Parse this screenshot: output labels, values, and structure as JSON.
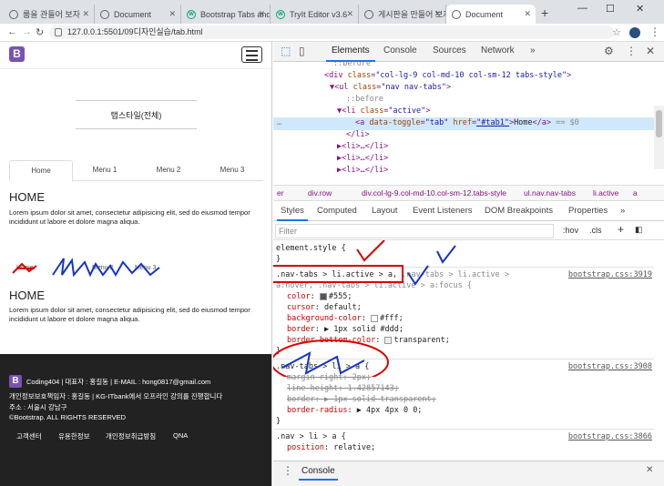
{
  "browser": {
    "tabs": [
      {
        "title": "룸을 관들어 보자",
        "icon": "globe-icon"
      },
      {
        "title": "Document",
        "icon": "globe-icon"
      },
      {
        "title": "Bootstrap Tabs and",
        "icon": "w3schools-icon"
      },
      {
        "title": "TryIt Editor v3.6",
        "icon": "w3schools-icon"
      },
      {
        "title": "게시판을 만들어 보자",
        "icon": "globe-icon"
      },
      {
        "title": "Document",
        "icon": "globe-icon",
        "active": true
      }
    ],
    "url": "127.0.0.1:5501/09디자인실습/tab.html"
  },
  "page": {
    "brand": "B",
    "section_title": "탭스타일(전체)",
    "tabs": [
      "Home",
      "Menu 1",
      "Menu 2",
      "Menu 3"
    ],
    "heading1": "HOME",
    "para1": "Lorem ipsum dolor sit amet, consectetur adipisicing elit, sed do eiusmod tempor incididunt ut labore et dolore magna aliqua.",
    "tabs2": [
      "Home",
      "Menu 2",
      "Menu 3"
    ],
    "heading2": "HOME",
    "para2": "Lorem ipsum dolor sit amet, consectetur adipisicing elit, sed do eiusmod tempor incididunt ut labore et dolore magna aliqua.",
    "footer": {
      "line1": "Coding404 | 대표자 : 홍길동 | E-MAIL : hong0817@gmail.com",
      "line2": "개인정보보호책임자 : 홍길동 | KG-ITbank에서 오프라인 강의를 진행합니다",
      "line3": "주소 : 서울시 강남구",
      "line4": "©Bootstrap. ALL RIGHTS RESERVED",
      "links": [
        "고객센터",
        "유용한정보",
        "개인정보취급방침",
        "QNA"
      ]
    }
  },
  "devtools": {
    "tabs": [
      "Elements",
      "Console",
      "Sources",
      "Network",
      "»"
    ],
    "dom": {
      "l0": "::before",
      "l1_tag": "<div ",
      "l1_attr": "class",
      "l1_val": "\"col-lg-9 col-md-10 col-sm-12 tabs-style\"",
      "l1_end": ">",
      "l2_tag": "▼<ul ",
      "l2_attr": "class",
      "l2_val": "\"nav nav-tabs\"",
      "l2_end": ">",
      "l3": "::before",
      "l4_tag": "▼<li ",
      "l4_attr": "class",
      "l4_val": "\"active\"",
      "l4_end": ">",
      "l5_tag": "<a ",
      "l5_attr1": "data-toggle",
      "l5_val1": "\"tab\"",
      "l5_attr2": "href",
      "l5_val2": "\"#tab1\"",
      "l5_text": "Home",
      "l5_end": "</a>",
      "l5_eq": "== $0",
      "l6": "</li>",
      "l7": "▶<li>…</li>",
      "l8": "▶<li>…</li>",
      "l9": "▶<li>…</li>"
    },
    "breadcrumbs": [
      "er",
      "div.row",
      "div.col-lg-9.col-md-10.col-sm-12.tabs-style",
      "ul.nav.nav-tabs",
      "li.active",
      "a"
    ],
    "subtabs": [
      "Styles",
      "Computed",
      "Layout",
      "Event Listeners",
      "DOM Breakpoints",
      "Properties",
      "»"
    ],
    "filter_placeholder": "Filter",
    "hov": ":hov",
    "cls": ".cls",
    "rules": {
      "element_style": "element.style {",
      "close": "}",
      "r1_sel1": ".nav-tabs > li.active > a,",
      "r1_sel2": " .nav-tabs > li.active >",
      "r1_sel3": "a:hover, .nav-tabs > li.active > a:focus {",
      "r1_src": "bootstrap.css:3919",
      "r1_props": [
        {
          "name": "color",
          "value": "#555;"
        },
        {
          "name": "cursor",
          "value": "default;"
        },
        {
          "name": "background-color",
          "value": "#fff;"
        },
        {
          "name": "border",
          "value": "▶ 1px solid #ddd;"
        },
        {
          "name": "border-bottom-color",
          "value": "transparent;"
        }
      ],
      "r2_sel": ".nav-tabs > li > a {",
      "r2_src": "bootstrap.css:3908",
      "r2_props": [
        {
          "name": "margin-right",
          "value": "2px;"
        },
        {
          "name": "line-height",
          "value": "1.42857143;"
        },
        {
          "name": "border",
          "value": "▶ 1px solid transparent;"
        },
        {
          "name": "border-radius",
          "value": "▶ 4px 4px 0 0;"
        }
      ],
      "r3_sel": ".nav > li > a {",
      "r3_src": "bootstrap.css:3866",
      "r3_props": [
        {
          "name": "position",
          "value": "relative;"
        }
      ]
    },
    "console_label": "Console"
  }
}
